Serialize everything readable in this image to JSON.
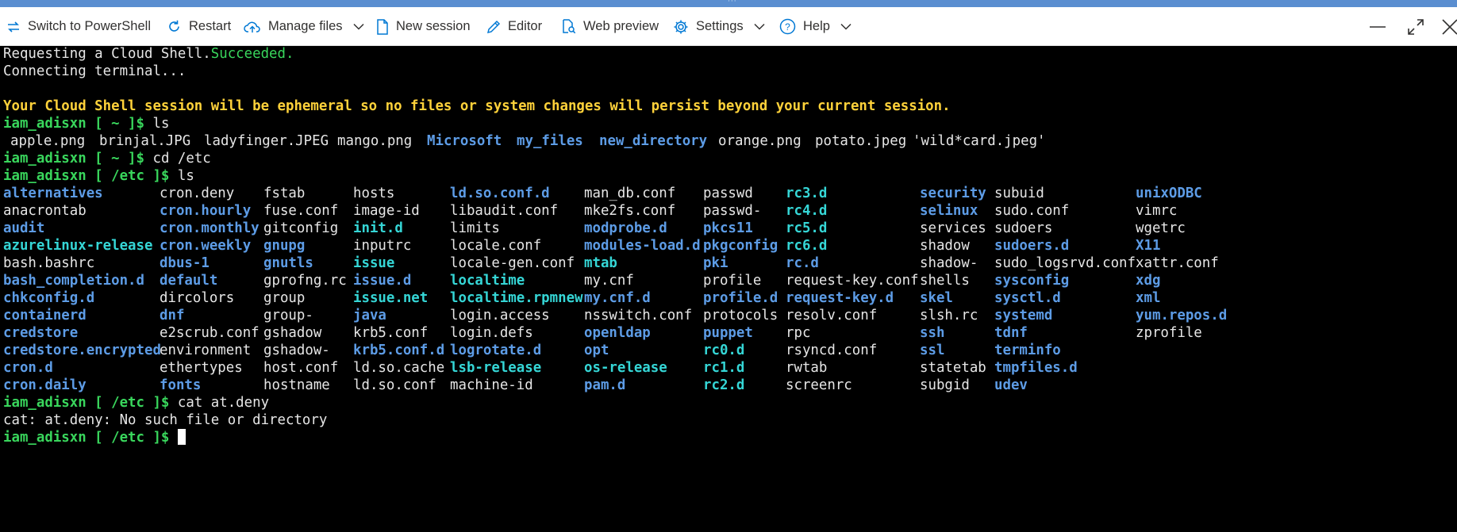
{
  "toolbar": {
    "switch_label": "Switch to PowerShell",
    "restart_label": "Restart",
    "manage_label": "Manage files",
    "new_session_label": "New session",
    "editor_label": "Editor",
    "web_preview_label": "Web preview",
    "settings_label": "Settings",
    "help_label": "Help"
  },
  "colors": {
    "directory": "#5d9ce6",
    "symlink": "#35d6d6",
    "prompt": "#39d65c",
    "warning": "#ffd23a"
  },
  "terminal": {
    "line1_text": "Requesting a Cloud Shell.",
    "line1_status": "Succeeded.",
    "line2": "Connecting terminal...",
    "warning": "Your Cloud Shell session will be ephemeral so no files or system changes will persist beyond your current session.",
    "prompts": {
      "home": "iam_adisxn [ ~ ]$",
      "etc": "iam_adisxn [ /etc ]$"
    },
    "cmd_ls": " ls",
    "cmd_cd": " cd /etc",
    "cmd_cat": " cat at.deny",
    "cat_error": "cat: at.deny: No such file or directory",
    "home_listing": [
      {
        "name": "apple.png",
        "kind": "file"
      },
      {
        "name": "brinjal.JPG",
        "kind": "file"
      },
      {
        "name": "ladyfinger.JPEG",
        "kind": "file"
      },
      {
        "name": "mango.png",
        "kind": "file"
      },
      {
        "name": "Microsoft",
        "kind": "dir"
      },
      {
        "name": "my_files",
        "kind": "dir"
      },
      {
        "name": "new_directory",
        "kind": "dir"
      },
      {
        "name": "orange.png",
        "kind": "file"
      },
      {
        "name": "potato.jpeg",
        "kind": "file"
      },
      {
        "name": "'wild*card.jpeg'",
        "kind": "file"
      }
    ],
    "etc_listing": [
      [
        {
          "name": "alternatives",
          "kind": "dir"
        },
        {
          "name": "anacrontab",
          "kind": "file"
        },
        {
          "name": "audit",
          "kind": "dir"
        },
        {
          "name": "azurelinux-release",
          "kind": "link"
        },
        {
          "name": "bash.bashrc",
          "kind": "file"
        },
        {
          "name": "bash_completion.d",
          "kind": "dir"
        },
        {
          "name": "chkconfig.d",
          "kind": "dir"
        },
        {
          "name": "containerd",
          "kind": "dir"
        },
        {
          "name": "credstore",
          "kind": "dir"
        },
        {
          "name": "credstore.encrypted",
          "kind": "dir"
        },
        {
          "name": "cron.d",
          "kind": "dir"
        },
        {
          "name": "cron.daily",
          "kind": "dir"
        }
      ],
      [
        {
          "name": "cron.deny",
          "kind": "file"
        },
        {
          "name": "cron.hourly",
          "kind": "dir"
        },
        {
          "name": "cron.monthly",
          "kind": "dir"
        },
        {
          "name": "cron.weekly",
          "kind": "dir"
        },
        {
          "name": "dbus-1",
          "kind": "dir"
        },
        {
          "name": "default",
          "kind": "dir"
        },
        {
          "name": "dircolors",
          "kind": "file"
        },
        {
          "name": "dnf",
          "kind": "dir"
        },
        {
          "name": "e2scrub.conf",
          "kind": "file"
        },
        {
          "name": "environment",
          "kind": "file"
        },
        {
          "name": "ethertypes",
          "kind": "file"
        },
        {
          "name": "fonts",
          "kind": "dir"
        }
      ],
      [
        {
          "name": "fstab",
          "kind": "file"
        },
        {
          "name": "fuse.conf",
          "kind": "file"
        },
        {
          "name": "gitconfig",
          "kind": "file"
        },
        {
          "name": "gnupg",
          "kind": "dir"
        },
        {
          "name": "gnutls",
          "kind": "dir"
        },
        {
          "name": "gprofng.rc",
          "kind": "file"
        },
        {
          "name": "group",
          "kind": "file"
        },
        {
          "name": "group-",
          "kind": "file"
        },
        {
          "name": "gshadow",
          "kind": "file"
        },
        {
          "name": "gshadow-",
          "kind": "file"
        },
        {
          "name": "host.conf",
          "kind": "file"
        },
        {
          "name": "hostname",
          "kind": "file"
        }
      ],
      [
        {
          "name": "hosts",
          "kind": "file"
        },
        {
          "name": "image-id",
          "kind": "file"
        },
        {
          "name": "init.d",
          "kind": "link"
        },
        {
          "name": "inputrc",
          "kind": "file"
        },
        {
          "name": "issue",
          "kind": "link"
        },
        {
          "name": "issue.d",
          "kind": "dir"
        },
        {
          "name": "issue.net",
          "kind": "link"
        },
        {
          "name": "java",
          "kind": "dir"
        },
        {
          "name": "krb5.conf",
          "kind": "file"
        },
        {
          "name": "krb5.conf.d",
          "kind": "dir"
        },
        {
          "name": "ld.so.cache",
          "kind": "file"
        },
        {
          "name": "ld.so.conf",
          "kind": "file"
        }
      ],
      [
        {
          "name": "ld.so.conf.d",
          "kind": "dir"
        },
        {
          "name": "libaudit.conf",
          "kind": "file"
        },
        {
          "name": "limits",
          "kind": "file"
        },
        {
          "name": "locale.conf",
          "kind": "file"
        },
        {
          "name": "locale-gen.conf",
          "kind": "file"
        },
        {
          "name": "localtime",
          "kind": "link"
        },
        {
          "name": "localtime.rpmnew",
          "kind": "link"
        },
        {
          "name": "login.access",
          "kind": "file"
        },
        {
          "name": "login.defs",
          "kind": "file"
        },
        {
          "name": "logrotate.d",
          "kind": "dir"
        },
        {
          "name": "lsb-release",
          "kind": "link"
        },
        {
          "name": "machine-id",
          "kind": "file"
        }
      ],
      [
        {
          "name": "man_db.conf",
          "kind": "file"
        },
        {
          "name": "mke2fs.conf",
          "kind": "file"
        },
        {
          "name": "modprobe.d",
          "kind": "dir"
        },
        {
          "name": "modules-load.d",
          "kind": "dir"
        },
        {
          "name": "mtab",
          "kind": "link"
        },
        {
          "name": "my.cnf",
          "kind": "file"
        },
        {
          "name": "my.cnf.d",
          "kind": "dir"
        },
        {
          "name": "nsswitch.conf",
          "kind": "file"
        },
        {
          "name": "openldap",
          "kind": "dir"
        },
        {
          "name": "opt",
          "kind": "dir"
        },
        {
          "name": "os-release",
          "kind": "link"
        },
        {
          "name": "pam.d",
          "kind": "dir"
        }
      ],
      [
        {
          "name": "passwd",
          "kind": "file"
        },
        {
          "name": "passwd-",
          "kind": "file"
        },
        {
          "name": "pkcs11",
          "kind": "dir"
        },
        {
          "name": "pkgconfig",
          "kind": "dir"
        },
        {
          "name": "pki",
          "kind": "dir"
        },
        {
          "name": "profile",
          "kind": "file"
        },
        {
          "name": "profile.d",
          "kind": "dir"
        },
        {
          "name": "protocols",
          "kind": "file"
        },
        {
          "name": "puppet",
          "kind": "dir"
        },
        {
          "name": "rc0.d",
          "kind": "link"
        },
        {
          "name": "rc1.d",
          "kind": "link"
        },
        {
          "name": "rc2.d",
          "kind": "link"
        }
      ],
      [
        {
          "name": "rc3.d",
          "kind": "link"
        },
        {
          "name": "rc4.d",
          "kind": "link"
        },
        {
          "name": "rc5.d",
          "kind": "link"
        },
        {
          "name": "rc6.d",
          "kind": "link"
        },
        {
          "name": "rc.d",
          "kind": "dir"
        },
        {
          "name": "request-key.conf",
          "kind": "file"
        },
        {
          "name": "request-key.d",
          "kind": "dir"
        },
        {
          "name": "resolv.conf",
          "kind": "file"
        },
        {
          "name": "rpc",
          "kind": "file"
        },
        {
          "name": "rsyncd.conf",
          "kind": "file"
        },
        {
          "name": "rwtab",
          "kind": "file"
        },
        {
          "name": "screenrc",
          "kind": "file"
        }
      ],
      [
        {
          "name": "security",
          "kind": "dir"
        },
        {
          "name": "selinux",
          "kind": "dir"
        },
        {
          "name": "services",
          "kind": "file"
        },
        {
          "name": "shadow",
          "kind": "file"
        },
        {
          "name": "shadow-",
          "kind": "file"
        },
        {
          "name": "shells",
          "kind": "file"
        },
        {
          "name": "skel",
          "kind": "dir"
        },
        {
          "name": "slsh.rc",
          "kind": "file"
        },
        {
          "name": "ssh",
          "kind": "dir"
        },
        {
          "name": "ssl",
          "kind": "dir"
        },
        {
          "name": "statetab",
          "kind": "file"
        },
        {
          "name": "subgid",
          "kind": "file"
        }
      ],
      [
        {
          "name": "subuid",
          "kind": "file"
        },
        {
          "name": "sudo.conf",
          "kind": "file"
        },
        {
          "name": "sudoers",
          "kind": "file"
        },
        {
          "name": "sudoers.d",
          "kind": "dir"
        },
        {
          "name": "sudo_logsrvd.conf",
          "kind": "file"
        },
        {
          "name": "sysconfig",
          "kind": "dir"
        },
        {
          "name": "sysctl.d",
          "kind": "dir"
        },
        {
          "name": "systemd",
          "kind": "dir"
        },
        {
          "name": "tdnf",
          "kind": "dir"
        },
        {
          "name": "terminfo",
          "kind": "dir"
        },
        {
          "name": "tmpfiles.d",
          "kind": "dir"
        },
        {
          "name": "udev",
          "kind": "dir"
        }
      ],
      [
        {
          "name": "unixODBC",
          "kind": "dir"
        },
        {
          "name": "vimrc",
          "kind": "file"
        },
        {
          "name": "wgetrc",
          "kind": "file"
        },
        {
          "name": "X11",
          "kind": "dir"
        },
        {
          "name": "xattr.conf",
          "kind": "file"
        },
        {
          "name": "xdg",
          "kind": "dir"
        },
        {
          "name": "xml",
          "kind": "dir"
        },
        {
          "name": "yum.repos.d",
          "kind": "dir"
        },
        {
          "name": "zprofile",
          "kind": "file"
        }
      ]
    ]
  }
}
